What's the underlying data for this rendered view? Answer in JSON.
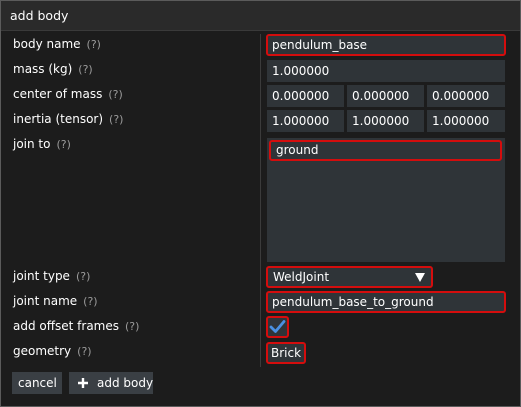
{
  "window": {
    "title": "add body"
  },
  "help_marker": "(?)",
  "rows": {
    "body_name": {
      "label": "body name",
      "value": "pendulum_base"
    },
    "mass": {
      "label": "mass (kg)",
      "value": "1.000000"
    },
    "center_of_mass": {
      "label": "center of mass",
      "values": [
        "0.000000",
        "0.000000",
        "0.000000"
      ]
    },
    "inertia": {
      "label": "inertia (tensor)",
      "values": [
        "1.000000",
        "1.000000",
        "1.000000"
      ]
    },
    "join_to": {
      "label": "join to",
      "items": [
        "ground"
      ]
    },
    "joint_type": {
      "label": "joint type",
      "value": "WeldJoint"
    },
    "joint_name": {
      "label": "joint name",
      "value": "pendulum_base_to_ground"
    },
    "add_offset_frames": {
      "label": "add offset frames",
      "checked": true
    },
    "geometry": {
      "label": "geometry",
      "value": "Brick"
    }
  },
  "buttons": {
    "cancel": "cancel",
    "add_body": "add body"
  },
  "icons": {
    "add": "plus-icon",
    "check": "checkmark-icon",
    "dropdown": "chevron-down-icon"
  },
  "colors": {
    "highlight": "#d40d0d",
    "field_bg": "#2f3438",
    "panel_bg": "#1c1c1c",
    "check": "#4a90e2"
  }
}
